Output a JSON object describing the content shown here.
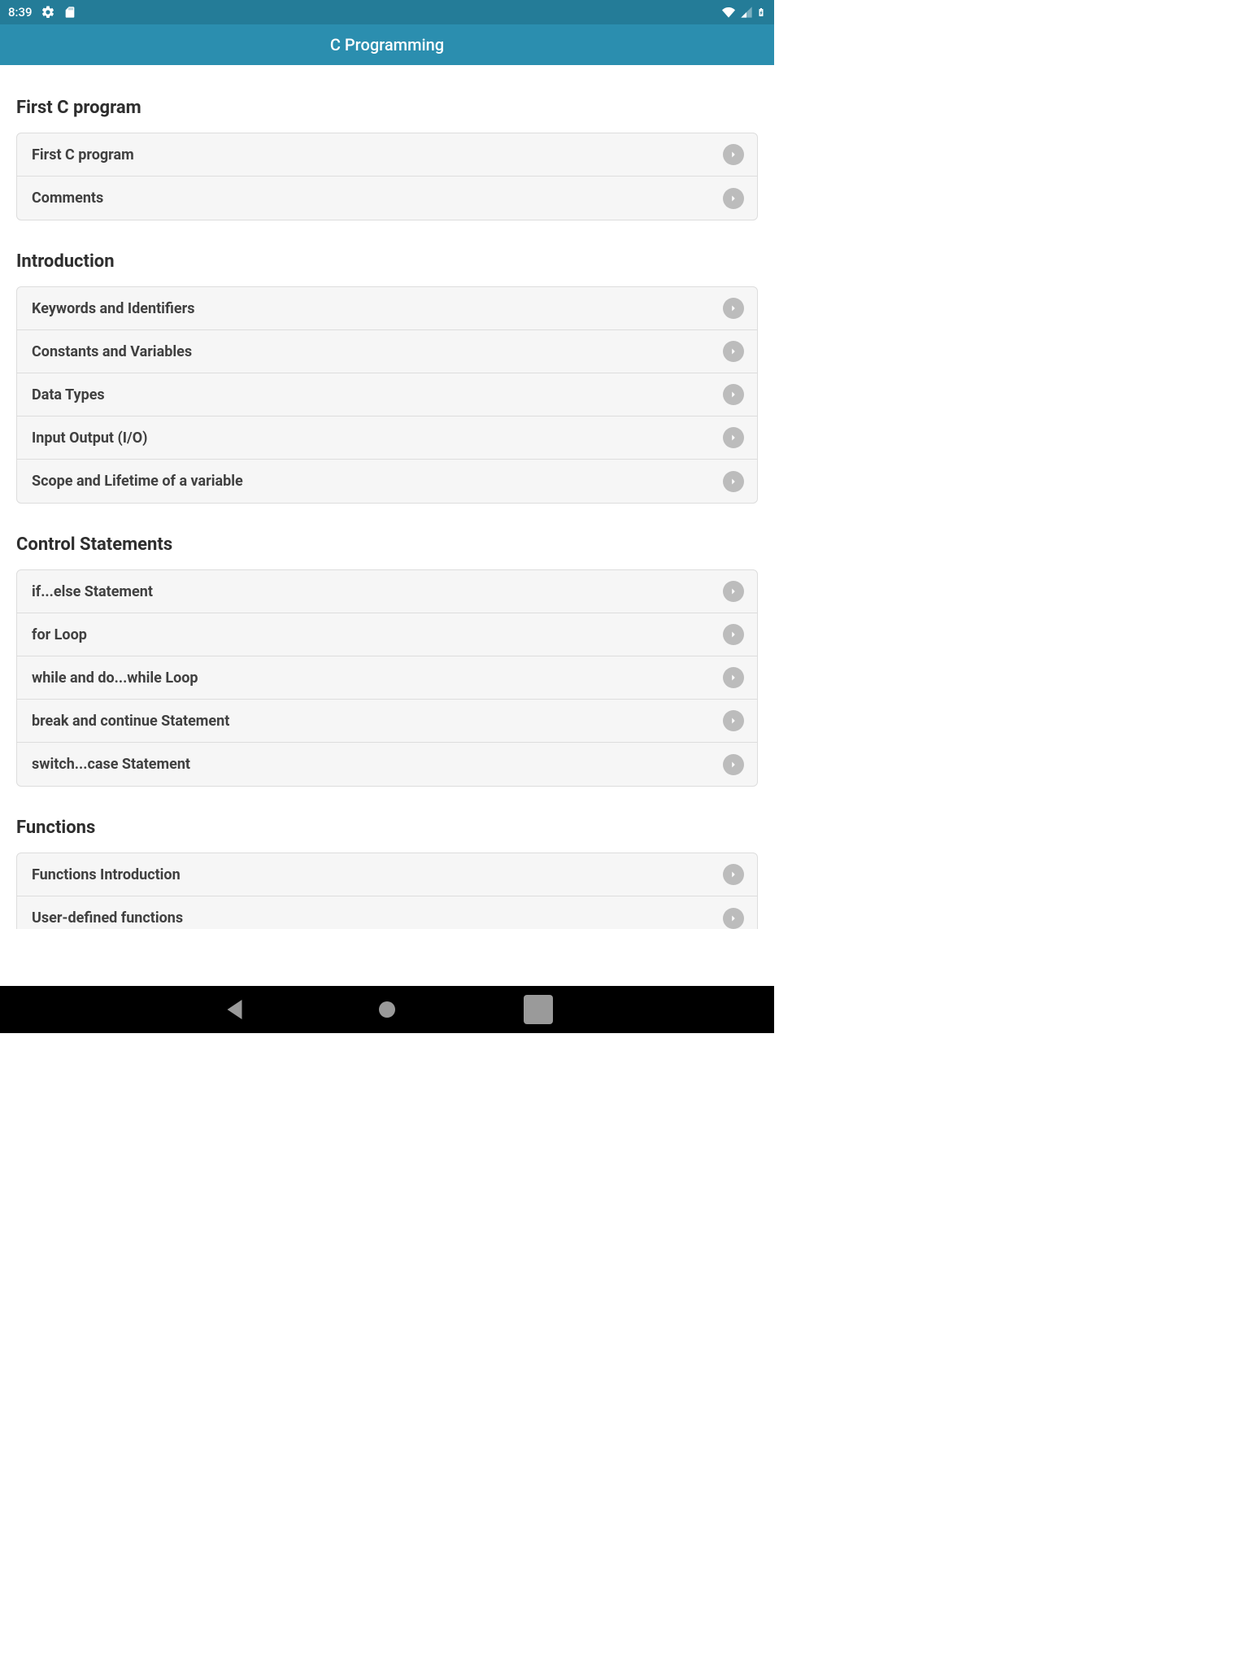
{
  "status_bar": {
    "time": "8:39"
  },
  "app_bar": {
    "title": "C Programming"
  },
  "sections": [
    {
      "title": "First C program",
      "items": [
        {
          "label": "First C program"
        },
        {
          "label": "Comments"
        }
      ]
    },
    {
      "title": "Introduction",
      "items": [
        {
          "label": "Keywords and Identifiers"
        },
        {
          "label": "Constants and Variables"
        },
        {
          "label": "Data Types"
        },
        {
          "label": "Input Output (I/O)"
        },
        {
          "label": "Scope and Lifetime of a variable"
        }
      ]
    },
    {
      "title": "Control Statements",
      "items": [
        {
          "label": "if...else Statement"
        },
        {
          "label": "for Loop"
        },
        {
          "label": "while and do...while Loop"
        },
        {
          "label": "break and continue Statement"
        },
        {
          "label": "switch...case Statement"
        }
      ]
    },
    {
      "title": "Functions",
      "items": [
        {
          "label": "Functions Introduction"
        },
        {
          "label": "User-defined functions"
        }
      ]
    }
  ]
}
